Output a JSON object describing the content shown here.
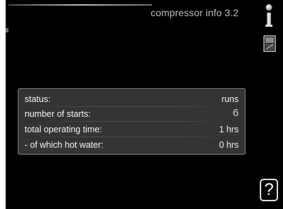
{
  "header": {
    "title": "compressor info 3.2"
  },
  "icons": {
    "thermometer": "thermometer-icon",
    "manual": "manual-book-icon",
    "help": "help-icon"
  },
  "help_button": {
    "label": "?"
  },
  "info": {
    "rows": [
      {
        "label": "status:",
        "value": "runs"
      },
      {
        "label": "number of starts:",
        "value": "6"
      },
      {
        "label": "total operating time:",
        "value": "1 hrs"
      },
      {
        "label": "- of which hot water:",
        "value": "0 hrs"
      }
    ]
  },
  "colors": {
    "background": "#000000",
    "panel": "#343434",
    "text": "#f4f4f4",
    "title": "#bdbdbd"
  }
}
